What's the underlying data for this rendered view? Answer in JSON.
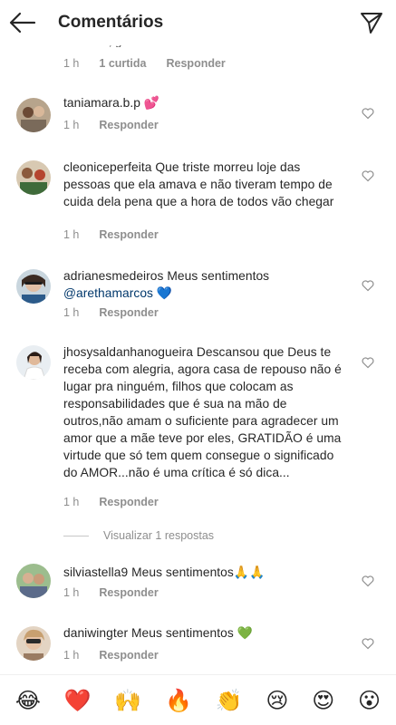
{
  "header": {
    "title": "Comentários",
    "back_icon": "arrow-left-icon",
    "send_icon": "paper-plane-icon"
  },
  "partial_comment": {
    "text": "saudade, gratidão",
    "time": "1 h",
    "likes": "1 curtida",
    "reply": "Responder"
  },
  "comments": [
    {
      "username": "taniamara.b.p",
      "text": "💕",
      "mention": "",
      "time": "1 h",
      "reply": "Responder"
    },
    {
      "username": "cleoniceperfeita",
      "text": "Que triste morreu loje das pessoas que ela amava e não tiveram tempo de cuida dela pena que a hora de todos vão chegar",
      "mention": "",
      "time": "1 h",
      "reply": "Responder"
    },
    {
      "username": "adrianesmedeiros",
      "text": "Meus sentimentos",
      "mention": "@arethamarcos 💙",
      "time": "1 h",
      "reply": "Responder"
    },
    {
      "username": "jhosysaldanhanogueira",
      "text": "Descansou que Deus te receba com alegria, agora casa de repouso não é lugar pra ninguém, filhos que colocam as responsabilidades que é sua na mão de outros,não amam o suficiente para agradecer um amor que a mãe teve por eles, GRATIDÃO é uma virtude que só tem quem consegue o significado do AMOR...não é uma crítica é só dica...",
      "mention": "",
      "time": "1 h",
      "reply": "Responder"
    },
    {
      "username": "silviastella9",
      "text": "Meus sentimentos🙏🙏",
      "mention": "",
      "time": "1 h",
      "reply": "Responder"
    },
    {
      "username": "daniwingter",
      "text": "Meus sentimentos 💚",
      "mention": "",
      "time": "1 h",
      "reply": "Responder"
    }
  ],
  "view_replies": "Visualizar 1 respostas",
  "emojis": [
    "😂",
    "❤️",
    "🙌",
    "🔥",
    "👏",
    "😢",
    "😍",
    "😮"
  ]
}
